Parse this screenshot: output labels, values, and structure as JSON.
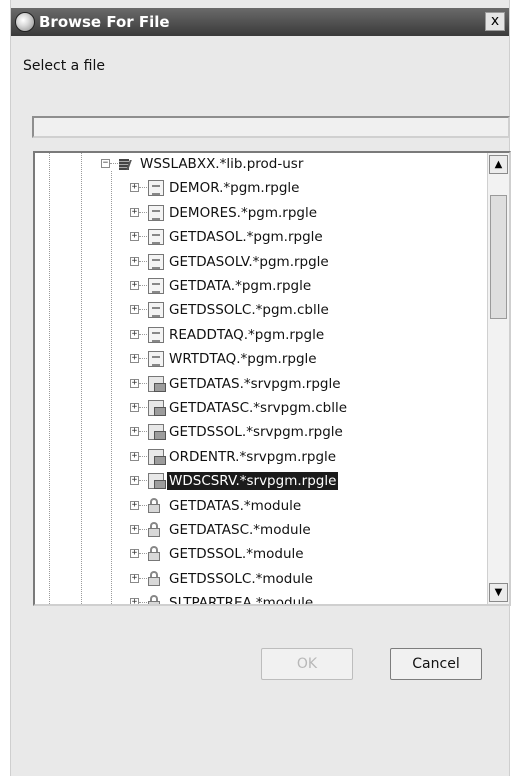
{
  "dialog": {
    "title": "Browse For File",
    "close_label": "x",
    "prompt": "Select a file",
    "path_value": ""
  },
  "tree": {
    "root": {
      "label": "WSSLABXX.*lib.prod-usr",
      "expander": "−",
      "icon": "library-icon"
    },
    "items": [
      {
        "label": "DEMOR.*pgm.rpgle",
        "icon": "program-icon",
        "expander": "+"
      },
      {
        "label": "DEMORES.*pgm.rpgle",
        "icon": "program-icon",
        "expander": "+"
      },
      {
        "label": "GETDASOL.*pgm.rpgle",
        "icon": "program-icon",
        "expander": "+"
      },
      {
        "label": "GETDASOLV.*pgm.rpgle",
        "icon": "program-icon",
        "expander": "+"
      },
      {
        "label": "GETDATA.*pgm.rpgle",
        "icon": "program-icon",
        "expander": "+"
      },
      {
        "label": "GETDSSOLC.*pgm.cblle",
        "icon": "program-icon",
        "expander": "+"
      },
      {
        "label": "READDTAQ.*pgm.rpgle",
        "icon": "program-icon",
        "expander": "+"
      },
      {
        "label": "WRTDTAQ.*pgm.rpgle",
        "icon": "program-icon",
        "expander": "+"
      },
      {
        "label": "GETDATAS.*srvpgm.rpgle",
        "icon": "service-program-icon",
        "expander": "+"
      },
      {
        "label": "GETDATASC.*srvpgm.cblle",
        "icon": "service-program-icon",
        "expander": "+"
      },
      {
        "label": "GETDSSOL.*srvpgm.rpgle",
        "icon": "service-program-icon",
        "expander": "+"
      },
      {
        "label": "ORDENTR.*srvpgm.rpgle",
        "icon": "service-program-icon",
        "expander": "+"
      },
      {
        "label": "WDSCSRV.*srvpgm.rpgle",
        "icon": "service-program-icon",
        "expander": "+",
        "selected": true
      },
      {
        "label": "GETDATAS.*module",
        "icon": "module-icon",
        "expander": "+"
      },
      {
        "label": "GETDATASC.*module",
        "icon": "module-icon",
        "expander": "+"
      },
      {
        "label": "GETDSSOL.*module",
        "icon": "module-icon",
        "expander": "+"
      },
      {
        "label": "GETDSSOLC.*module",
        "icon": "module-icon",
        "expander": "+"
      },
      {
        "label": "SLTPARTREA.*module",
        "icon": "module-icon",
        "expander": "+"
      }
    ],
    "scroll_up": "▲",
    "scroll_down": "▼"
  },
  "buttons": {
    "ok_label": "OK",
    "ok_enabled": false,
    "cancel_label": "Cancel"
  },
  "colors": {
    "selection_bg": "#1b1b1b",
    "selection_fg": "#ffffff",
    "titlebar": "#4a4a4a"
  }
}
